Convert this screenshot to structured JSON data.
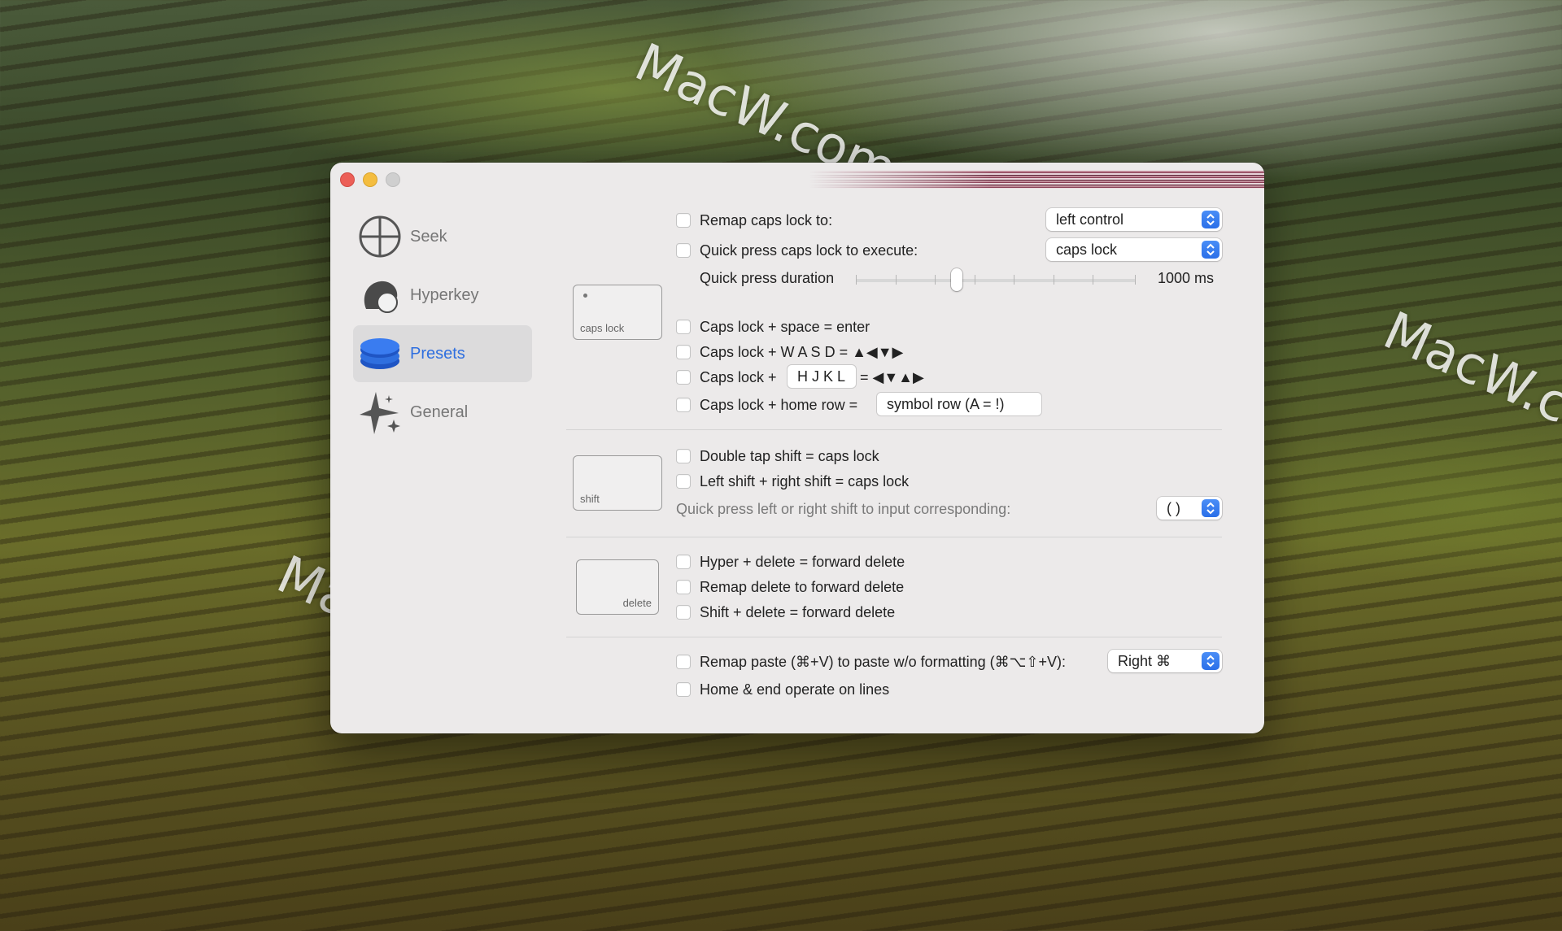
{
  "watermark": "MacW.com",
  "sidebar": {
    "items": [
      {
        "label": "Seek",
        "icon": "crosshair-icon",
        "active": false
      },
      {
        "label": "Hyperkey",
        "icon": "hyperkey-head-icon",
        "active": false
      },
      {
        "label": "Presets",
        "icon": "presets-stack-icon",
        "active": true
      },
      {
        "label": "General",
        "icon": "sparkle-icon",
        "active": false
      }
    ]
  },
  "capslock": {
    "key_label": "caps lock",
    "remap_label": "Remap caps lock to:",
    "remap_value": "left control",
    "quick_press_label": "Quick press caps lock to execute:",
    "quick_press_value": "caps lock",
    "duration_label": "Quick press duration",
    "duration_value": "1000 ms",
    "duration_fraction": 0.36,
    "space_enter_label": "Caps lock + space = enter",
    "wasd_label": "Caps lock + W A S D = ▲◀▼▶",
    "hjkl_prefix": "Caps lock +",
    "hjkl_field": "H J K L",
    "hjkl_suffix": "= ◀▼▲▶",
    "home_row_label": "Caps lock + home row =",
    "home_row_value": "symbol row (A = !)"
  },
  "shift": {
    "key_label": "shift",
    "double_tap_label": "Double tap shift = caps lock",
    "left_right_label": "Left shift + right shift = caps lock",
    "quick_press_label": "Quick press left or right shift to input corresponding:",
    "quick_press_value": "( )"
  },
  "delete": {
    "key_label": "delete",
    "hyper_label": "Hyper + delete = forward delete",
    "remap_label": "Remap delete to forward delete",
    "shift_label": "Shift + delete = forward delete"
  },
  "misc": {
    "paste_label": "Remap paste (⌘+V) to paste w/o formatting (⌘⌥⇧+V):",
    "paste_value": "Right ⌘",
    "home_end_label": "Home & end operate on lines"
  },
  "colors": {
    "accent": "#2f6fdf",
    "close": "#ec5f57",
    "minimize": "#f4bd3f",
    "zoom_disabled": "#cfcfcf"
  }
}
